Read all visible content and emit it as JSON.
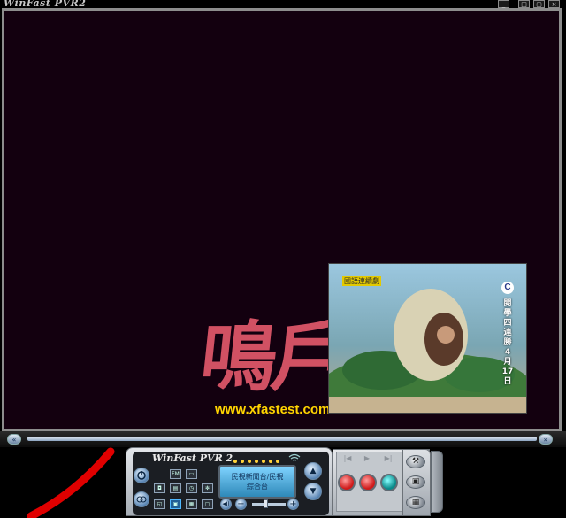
{
  "window": {
    "title": "WinFast PVR2",
    "controls": {
      "minimize": "_",
      "restore": "□",
      "maximize": "▢",
      "close": "×"
    }
  },
  "video": {
    "watermark_chars": "鳴戶",
    "watermark_url": "www.xfastest.com",
    "pip": {
      "caption": "國語連續劇",
      "channel_logo": "C",
      "vertical_text": "閱學四連勝4月17日"
    }
  },
  "seekbar": {
    "prev_icon": "«",
    "next_icon": "»"
  },
  "panel": {
    "brand": "WinFast PVR 2",
    "lcd_line1": "民視新聞台/民視",
    "lcd_line2": "綜合台",
    "signal_icon": "wifi-icon",
    "buttons": {
      "fm": "FM",
      "up": "▲",
      "down": "▼",
      "minus": "−",
      "plus": "+",
      "mute": "◀)"
    }
  },
  "transport": {
    "rec_icon": "|◀",
    "play_icon": "▶",
    "next_icon": "▶|",
    "wrench_icon": "⚒",
    "lock_icon": "▣",
    "keypad_icon": "▦"
  },
  "colors": {
    "frame": "#8d8d8d",
    "video_bg": "#13000f",
    "watermark_url": "#ffd400",
    "lcd": "#4aaee0"
  }
}
